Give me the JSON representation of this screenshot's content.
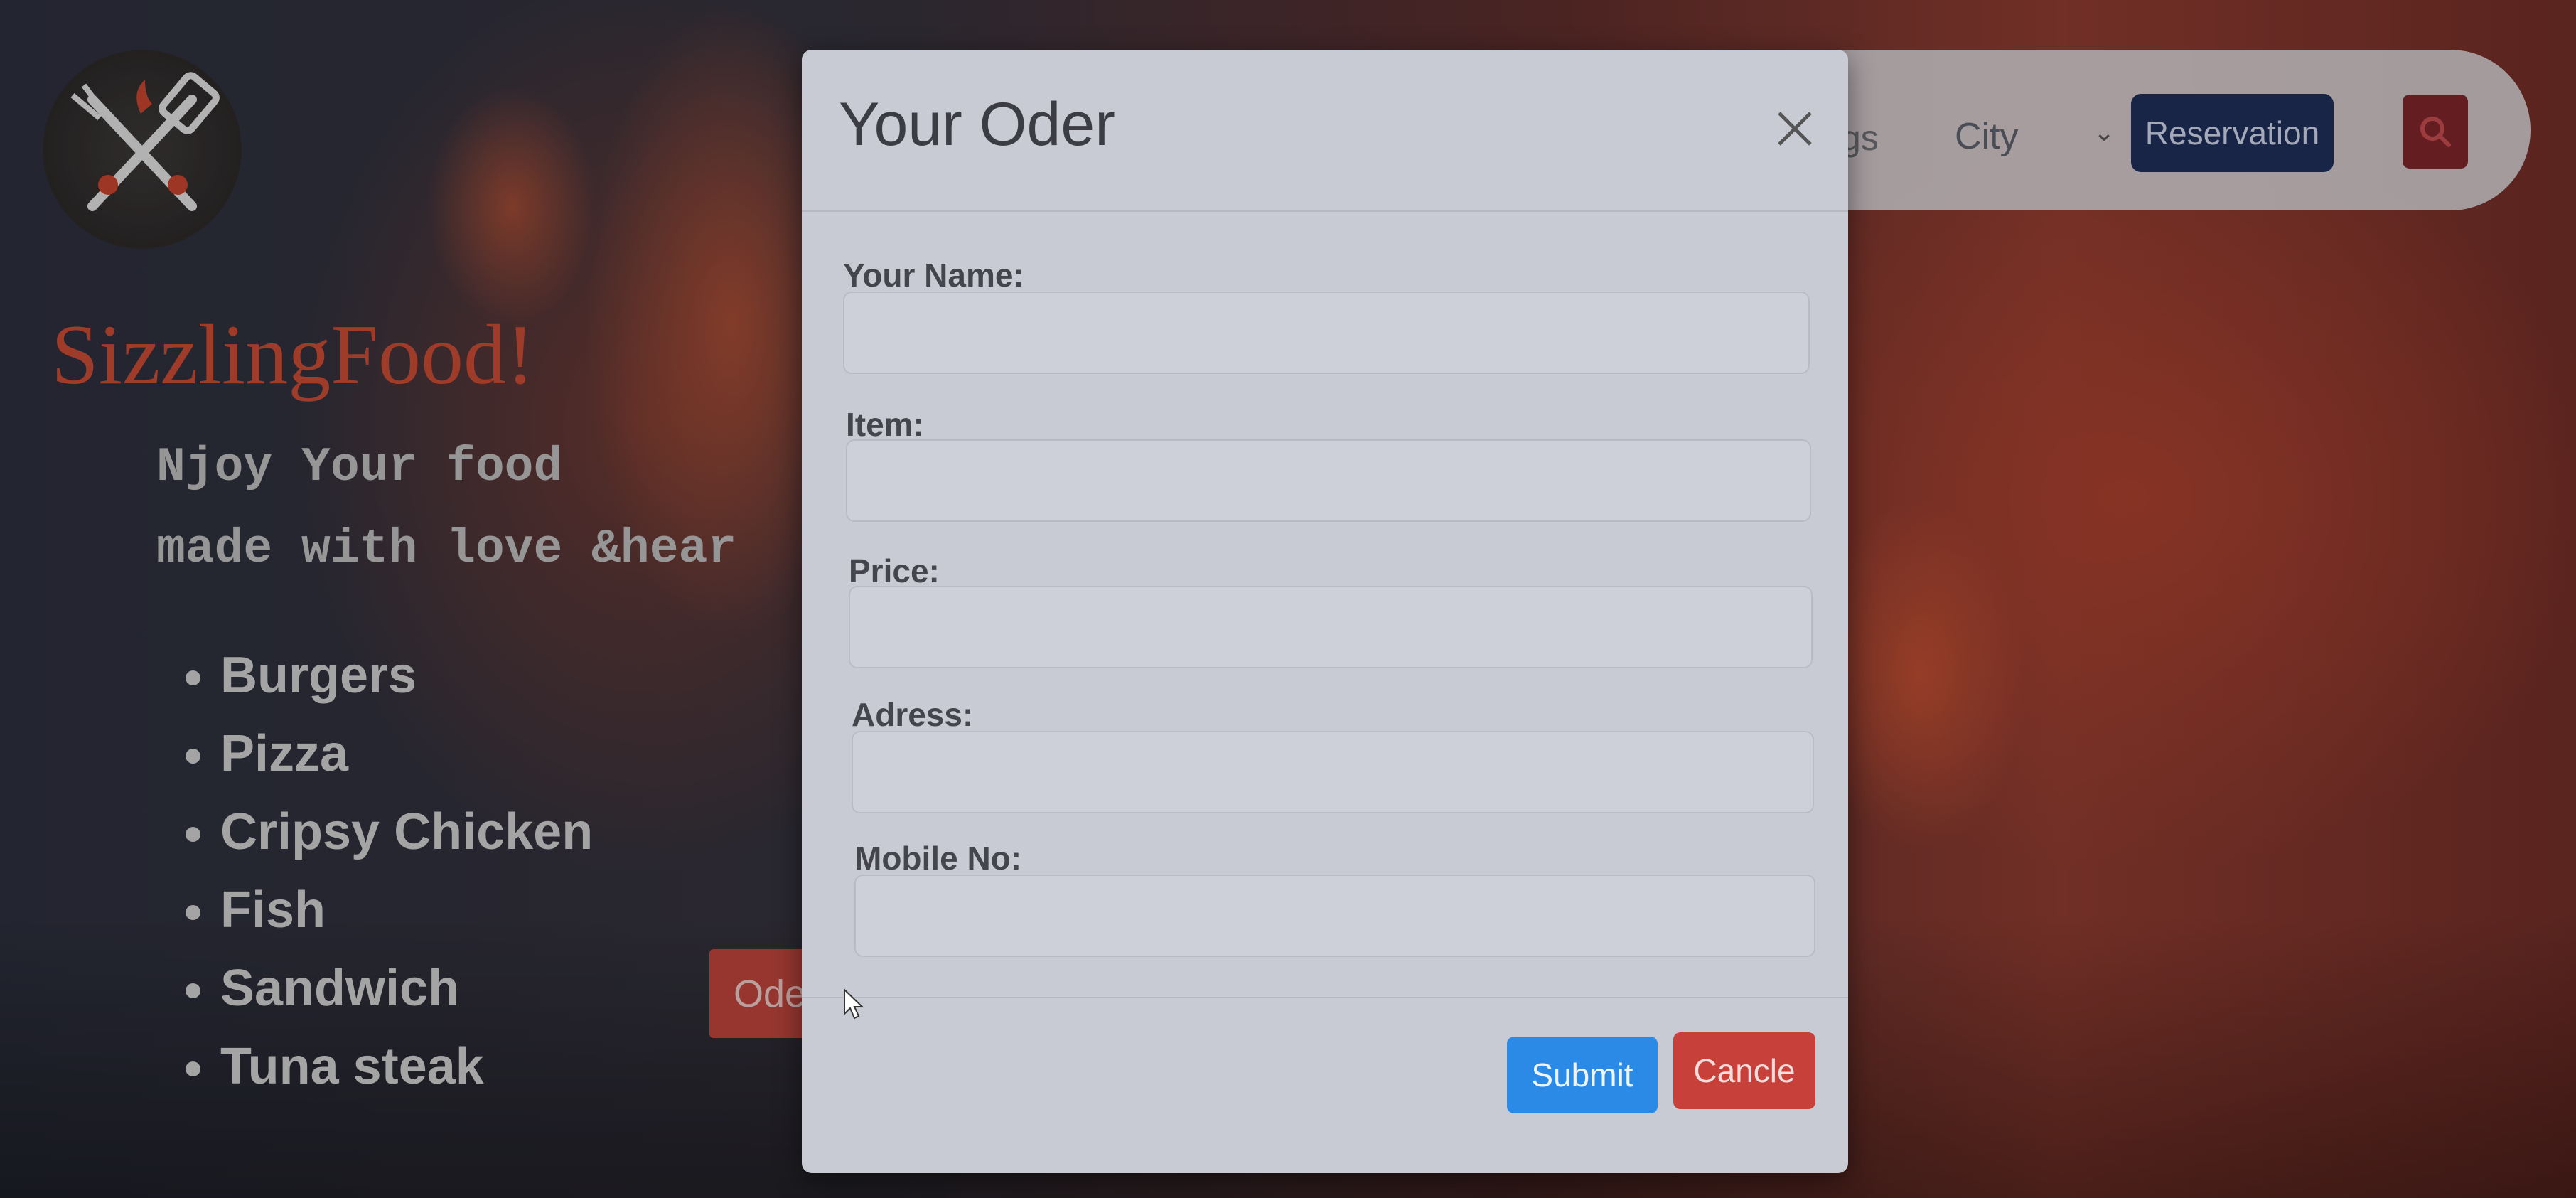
{
  "hero": {
    "brand": "SizzlingFood!",
    "tagline_line1": "Njoy Your food",
    "tagline_line2": "made with love &hear",
    "menu_items": [
      "Burgers",
      "Pizza",
      "Cripsy Chicken",
      "Fish",
      "Sandwich",
      "Tuna steak"
    ],
    "order_button": "Oder"
  },
  "navbar": {
    "partial_item": "gs",
    "city_select": "City",
    "reservation_button": "Reservation",
    "search_icon": "search-icon"
  },
  "modal": {
    "title": "Your Oder",
    "close_icon": "close-icon",
    "fields": [
      {
        "label": "Your Name:",
        "value": ""
      },
      {
        "label": "Item:",
        "value": ""
      },
      {
        "label": "Price:",
        "value": ""
      },
      {
        "label": "Adress:",
        "value": ""
      },
      {
        "label": "Mobile No:",
        "value": ""
      }
    ],
    "submit_label": "Submit",
    "cancel_label": "Cancle"
  },
  "colors": {
    "brand_red": "#c24a33",
    "submit_blue": "#2a8ae6",
    "cancel_red": "#c8403a",
    "reservation_navy": "#1f2e57"
  }
}
